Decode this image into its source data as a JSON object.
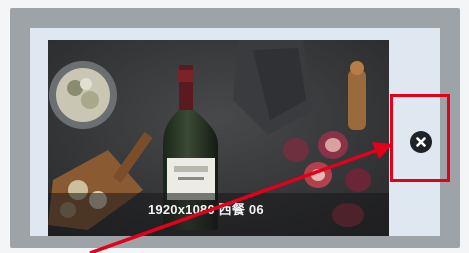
{
  "thumbnail": {
    "caption": "1920x1080 西餐 06"
  },
  "close_button": {
    "icon": "close-icon"
  },
  "annotation": {
    "color": "#e2001a",
    "arrow_icon": "arrow-icon",
    "box": "highlight-box"
  }
}
